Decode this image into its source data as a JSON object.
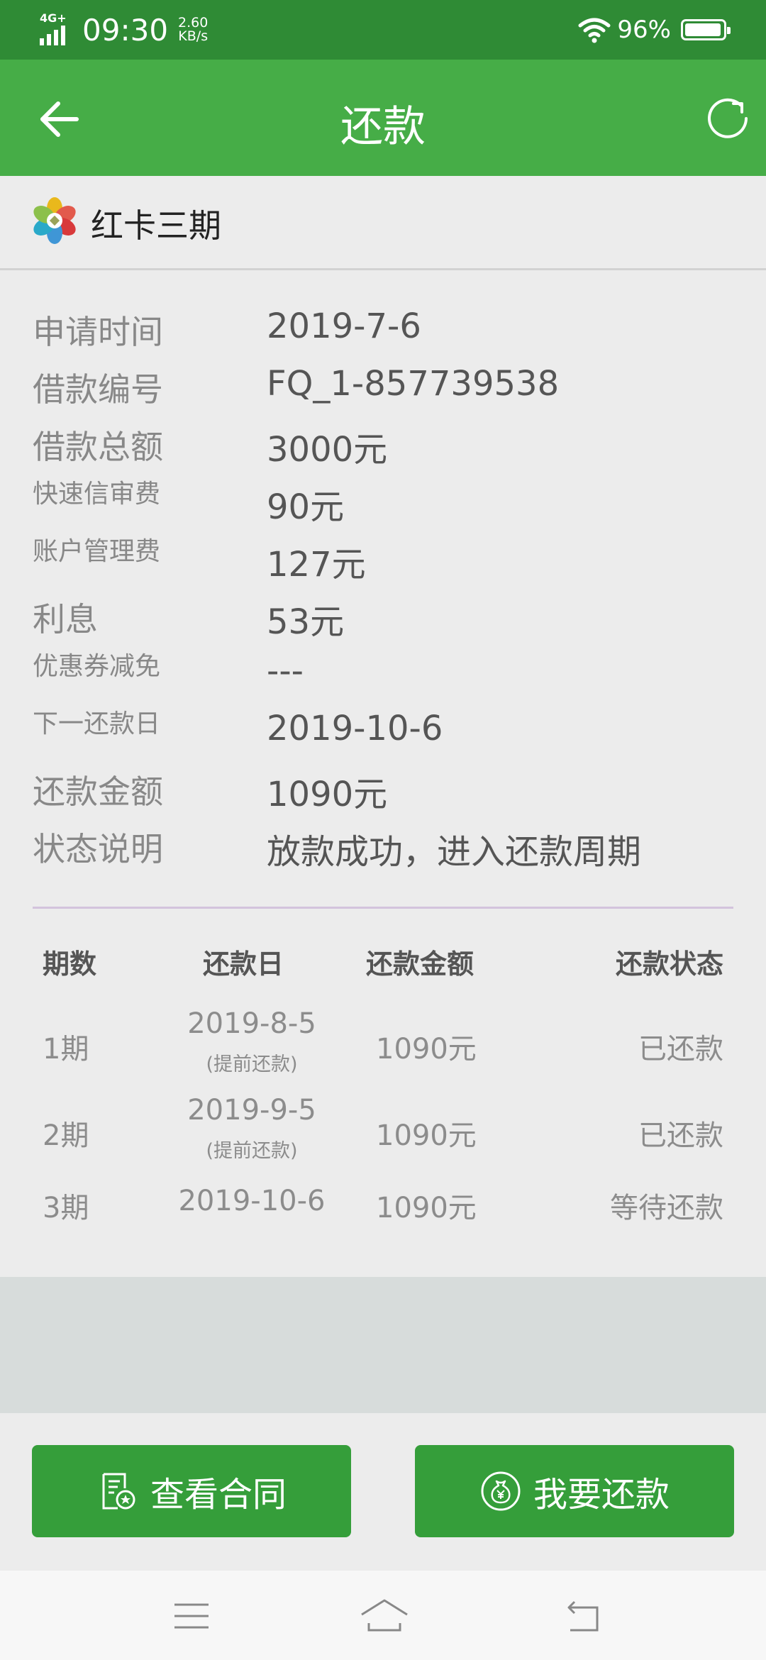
{
  "status_bar": {
    "network": "4G+",
    "time": "09:30",
    "speed_value": "2.60",
    "speed_unit": "KB/s",
    "battery_percent": "96%",
    "battery_level": 0.96
  },
  "app_bar": {
    "title": "还款",
    "back_icon": "arrow-left-icon",
    "refresh_icon": "refresh-icon"
  },
  "product": {
    "name": "红卡三期",
    "logo_icon": "flower-logo-icon"
  },
  "loan_info": [
    {
      "label": "申请时间",
      "value": "2019-7-6",
      "size": "big"
    },
    {
      "label": "借款编号",
      "value": "FQ_1-857739538",
      "size": "big"
    },
    {
      "label": "借款总额",
      "value": "3000元",
      "size": "big"
    },
    {
      "label": "快速信审费",
      "value": "90元",
      "size": "small"
    },
    {
      "label": "账户管理费",
      "value": "127元",
      "size": "small"
    },
    {
      "label": "利息",
      "value": "53元",
      "size": "big"
    },
    {
      "label": "优惠券减免",
      "value": "---",
      "size": "small"
    },
    {
      "label": "下一还款日",
      "value": "2019-10-6",
      "size": "small"
    },
    {
      "label": "还款金额",
      "value": "1090元",
      "size": "big"
    },
    {
      "label": "状态说明",
      "value": "放款成功，进入还款周期",
      "size": "big"
    }
  ],
  "schedule": {
    "headers": {
      "period": "期数",
      "date": "还款日",
      "amount": "还款金额",
      "status": "还款状态"
    },
    "rows": [
      {
        "period": "1期",
        "date": "2019-8-5",
        "note": "(提前还款)",
        "amount": "1090元",
        "status": "已还款"
      },
      {
        "period": "2期",
        "date": "2019-9-5",
        "note": "(提前还款)",
        "amount": "1090元",
        "status": "已还款"
      },
      {
        "period": "3期",
        "date": "2019-10-6",
        "note": "",
        "amount": "1090元",
        "status": "等待还款"
      }
    ]
  },
  "actions": {
    "contract_label": "查看合同",
    "contract_icon": "contract-document-icon",
    "repay_label": "我要还款",
    "repay_icon": "money-bag-icon"
  },
  "nav": {
    "menu_icon": "menu-icon",
    "home_icon": "home-icon",
    "back_icon": "back-icon"
  },
  "colors": {
    "status_bar": "#2f8b35",
    "app_bar": "#46ad47",
    "button": "#359e3a",
    "background": "#ececec"
  }
}
